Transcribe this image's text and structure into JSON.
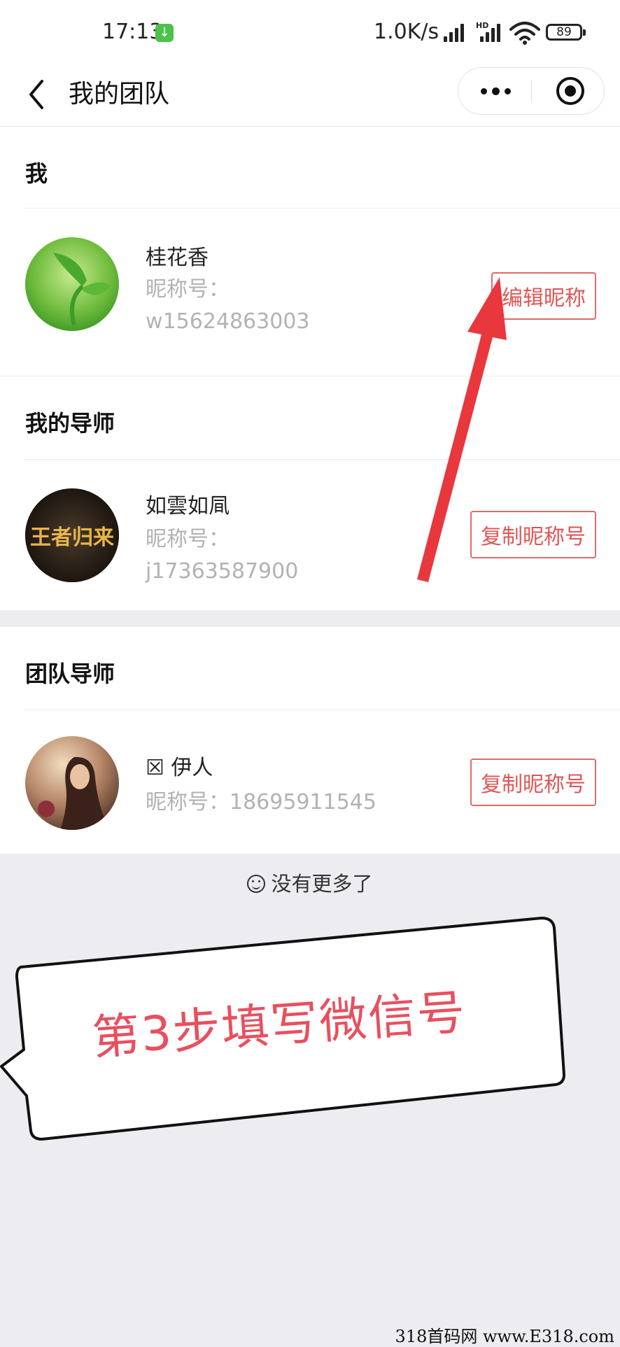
{
  "status_bar": {
    "time": "17:13",
    "download_glyph": "↓",
    "speed": "1.0K/s",
    "hd": "HD",
    "battery": "89"
  },
  "navbar": {
    "title": "我的团队",
    "icons": {
      "back": "chevron-left-icon",
      "more": "more-dots-icon",
      "close": "record-close-icon"
    }
  },
  "sections": {
    "me": {
      "title": "我",
      "name": "桂花香",
      "nick_label": "昵称号：",
      "nick_value": "w15624863003",
      "button": "编辑昵称"
    },
    "mentor": {
      "title": "我的导师",
      "name": "如雲如凬",
      "nick_label": "昵称号：",
      "nick_value": "j17363587900",
      "avatar_text": "王者归来",
      "button": "复制昵称号"
    },
    "team_mentor": {
      "title": "团队导师",
      "name": "☒ 伊人",
      "nick_label": "昵称号：",
      "nick_value": "18695911545",
      "button": "复制昵称号"
    }
  },
  "footer": {
    "no_more": "没有更多了"
  },
  "annotation": {
    "callout": "第3步填写微信号",
    "arrow_color": "#e8383d"
  },
  "watermark": "318首码网 www.E318.com",
  "colors": {
    "accent": "#e05656",
    "background": "#ededf1"
  }
}
